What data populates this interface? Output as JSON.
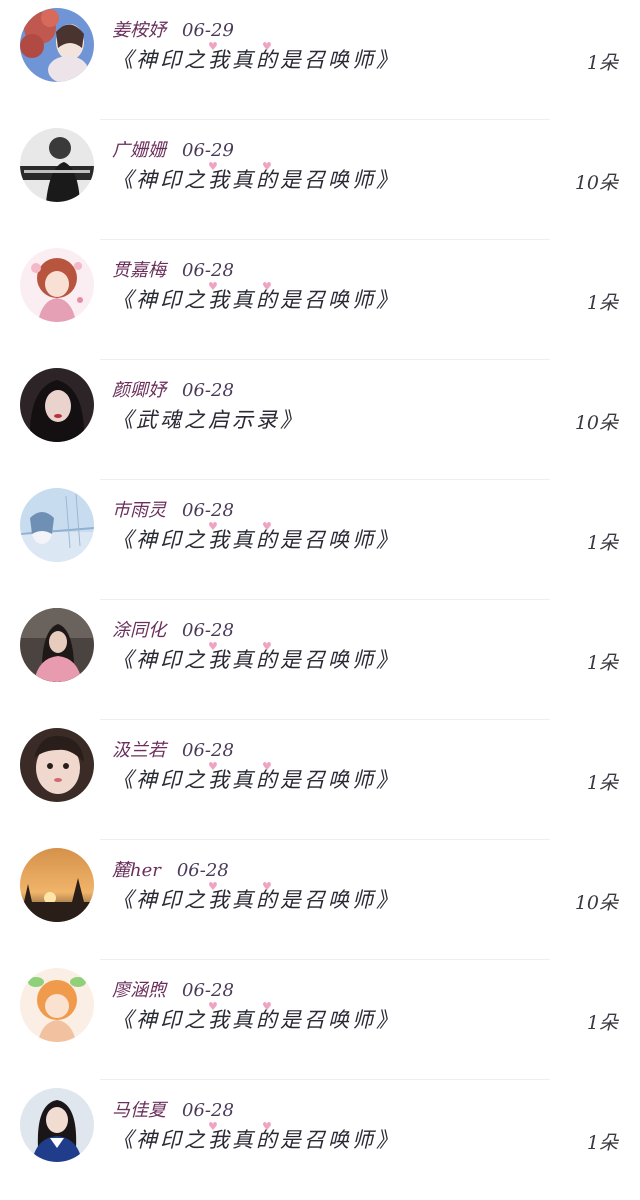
{
  "rows": [
    {
      "name": "姜桉妤",
      "date": "06-29",
      "title": "《神印之我真的是召唤师》",
      "count": "1朵",
      "avatar": "avatar-cherry-blossom"
    },
    {
      "name": "广姗姗",
      "date": "06-29",
      "title": "《神印之我真的是召唤师》",
      "count": "10朵",
      "avatar": "avatar-monochrome-figure"
    },
    {
      "name": "贯嘉梅",
      "date": "06-28",
      "title": "《神印之我真的是召唤师》",
      "count": "1朵",
      "avatar": "avatar-anime-girl-red"
    },
    {
      "name": "颜卿妤",
      "date": "06-28",
      "title": "《武魂之启示录》",
      "count": "10朵",
      "avatar": "avatar-dark-hair-girl"
    },
    {
      "name": "巿雨灵",
      "date": "06-28",
      "title": "《神印之我真的是召唤师》",
      "count": "1朵",
      "avatar": "avatar-blue-sky-anime"
    },
    {
      "name": "涂同化",
      "date": "06-28",
      "title": "《神印之我真的是召唤师》",
      "count": "1朵",
      "avatar": "avatar-girl-pink-sweater"
    },
    {
      "name": "汲兰若",
      "date": "06-28",
      "title": "《神印之我真的是召唤师》",
      "count": "1朵",
      "avatar": "avatar-girl-closeup"
    },
    {
      "name": "麓her",
      "date": "06-28",
      "title": "《神印之我真的是召唤师》",
      "count": "10朵",
      "avatar": "avatar-sunset"
    },
    {
      "name": "廖涵煦",
      "date": "06-28",
      "title": "《神印之我真的是召唤师》",
      "count": "1朵",
      "avatar": "avatar-anime-orange-hair"
    },
    {
      "name": "马佳夏",
      "date": "06-28",
      "title": "《神印之我真的是召唤师》",
      "count": "1朵",
      "avatar": "avatar-girl-sailor-uniform"
    }
  ],
  "colors": {
    "name": "#6b2f5c",
    "date": "#4a3a5a",
    "title": "#2a2a34",
    "heart_decoration": "#f1a3c2",
    "divider": "#f0eef0"
  }
}
